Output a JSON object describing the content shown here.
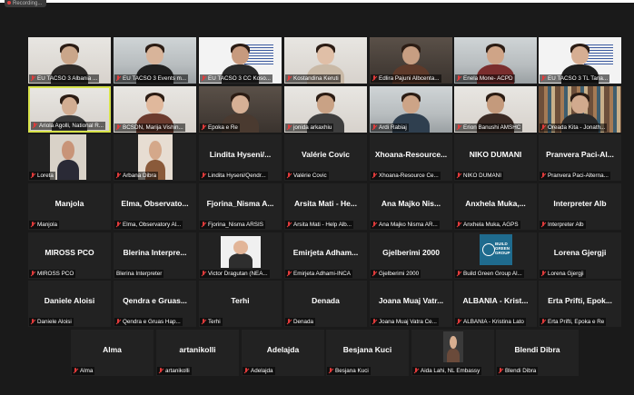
{
  "recording": {
    "label": "Recording..."
  },
  "rows": [
    [
      {
        "label": "EU TACSO 3 Albania ...",
        "kind": "video"
      },
      {
        "label": "EU TACSO 3 Events m...",
        "kind": "video"
      },
      {
        "label": "EU TACSO 3 CC Koso...",
        "kind": "video"
      },
      {
        "label": "Kostandina Keruti",
        "kind": "video"
      },
      {
        "label": "Edlira Pajuni Albcenta...",
        "kind": "video"
      },
      {
        "label": "Enela Mone- ACPD",
        "kind": "video"
      },
      {
        "label": "EU TACSO 3 TL Tana...",
        "kind": "video"
      }
    ],
    [
      {
        "label": "Ariola Agolli, National R...",
        "kind": "video",
        "active": true
      },
      {
        "label": "BCSDN, Marija Vishin...",
        "kind": "video"
      },
      {
        "label": "Epoka e Re",
        "kind": "video"
      },
      {
        "label": "jonida arkaxhiu",
        "kind": "video"
      },
      {
        "label": "Ardi Rabiaj",
        "kind": "video"
      },
      {
        "label": "Erion Banushi AMSHC",
        "kind": "video"
      },
      {
        "label": "Oreada Kita - Jonath...",
        "kind": "video"
      }
    ],
    [
      {
        "label": "Loreta",
        "kind": "pic"
      },
      {
        "label": "Arbana Dibra",
        "kind": "pic"
      },
      {
        "name": "Lindita Hyseni/...",
        "label": "Lindita Hyseni/Qendr..."
      },
      {
        "name": "Valérie Covic",
        "label": "Valérie Covic"
      },
      {
        "name": "Xhoana-Resource...",
        "label": "Xhoana-Resource Ce..."
      },
      {
        "name": "NIKO DUMANI",
        "label": "NIKO DUMANI"
      },
      {
        "name": "Pranvera Paci-Al...",
        "label": "Pranvera Paci-Alterna..."
      }
    ],
    [
      {
        "name": "Manjola",
        "label": "Manjola"
      },
      {
        "name": "Elma, Observato...",
        "label": "Elma, Observatory Al..."
      },
      {
        "name": "Fjorina_Nisma A...",
        "label": "Fjorina_Nisma ARSIS"
      },
      {
        "name": "Arsita Mati - He...",
        "label": "Arsita Mati - Help Alb..."
      },
      {
        "name": "Ana Majko Nis...",
        "label": "Ana Majko Nisma AR..."
      },
      {
        "name": "Anxhela Muka,...",
        "label": "Anxhela Muka, AGPS"
      },
      {
        "name": "Interpreter Alb",
        "label": "Interpreter Alb"
      }
    ],
    [
      {
        "name": "MIROSS PCO",
        "label": "MIROSS PCO"
      },
      {
        "name": "Blerina Interpre...",
        "label": "Blerina Interpreter",
        "nomic": true
      },
      {
        "label": "Victor Dragutan (NEA...",
        "kind": "pic"
      },
      {
        "name": "Emirjeta Adham...",
        "label": "Emirjeta Adhami-INCA"
      },
      {
        "name": "Gjelberimi 2000",
        "label": "Gjelberimi 2000"
      },
      {
        "label": "Build Green Group Al...",
        "kind": "logo",
        "logo_text": "BUILD GREEN GROUP"
      },
      {
        "name": "Lorena Gjergji",
        "label": "Lorena Gjergji"
      }
    ],
    [
      {
        "name": "Daniele Aloisi",
        "label": "Daniele Aloisi"
      },
      {
        "name": "Qendra e Gruas...",
        "label": "Qendra e Gruas Hap..."
      },
      {
        "name": "Terhi",
        "label": "Terhi"
      },
      {
        "name": "Denada",
        "label": "Denada"
      },
      {
        "name": "Joana Muaj Vatr...",
        "label": "Joana Muaj Vatra Ce..."
      },
      {
        "name": "ALBANIA - Krist...",
        "label": "ALBANIA - Kristina Lato"
      },
      {
        "name": "Erta Prifti, Epok...",
        "label": "Erta Prifti, Epoka e Re"
      }
    ],
    [
      {
        "name": "Alma",
        "label": "Alma"
      },
      {
        "name": "artanikolli",
        "label": "artanikolli"
      },
      {
        "name": "Adelajda",
        "label": "Adelajda"
      },
      {
        "name": "Besjana Kuci",
        "label": "Besjana Kuci"
      },
      {
        "label": "Aida Lahi, NL Embassy",
        "kind": "pic"
      },
      {
        "name": "Blendi Dibra",
        "label": "Blendi Dibra"
      }
    ]
  ]
}
